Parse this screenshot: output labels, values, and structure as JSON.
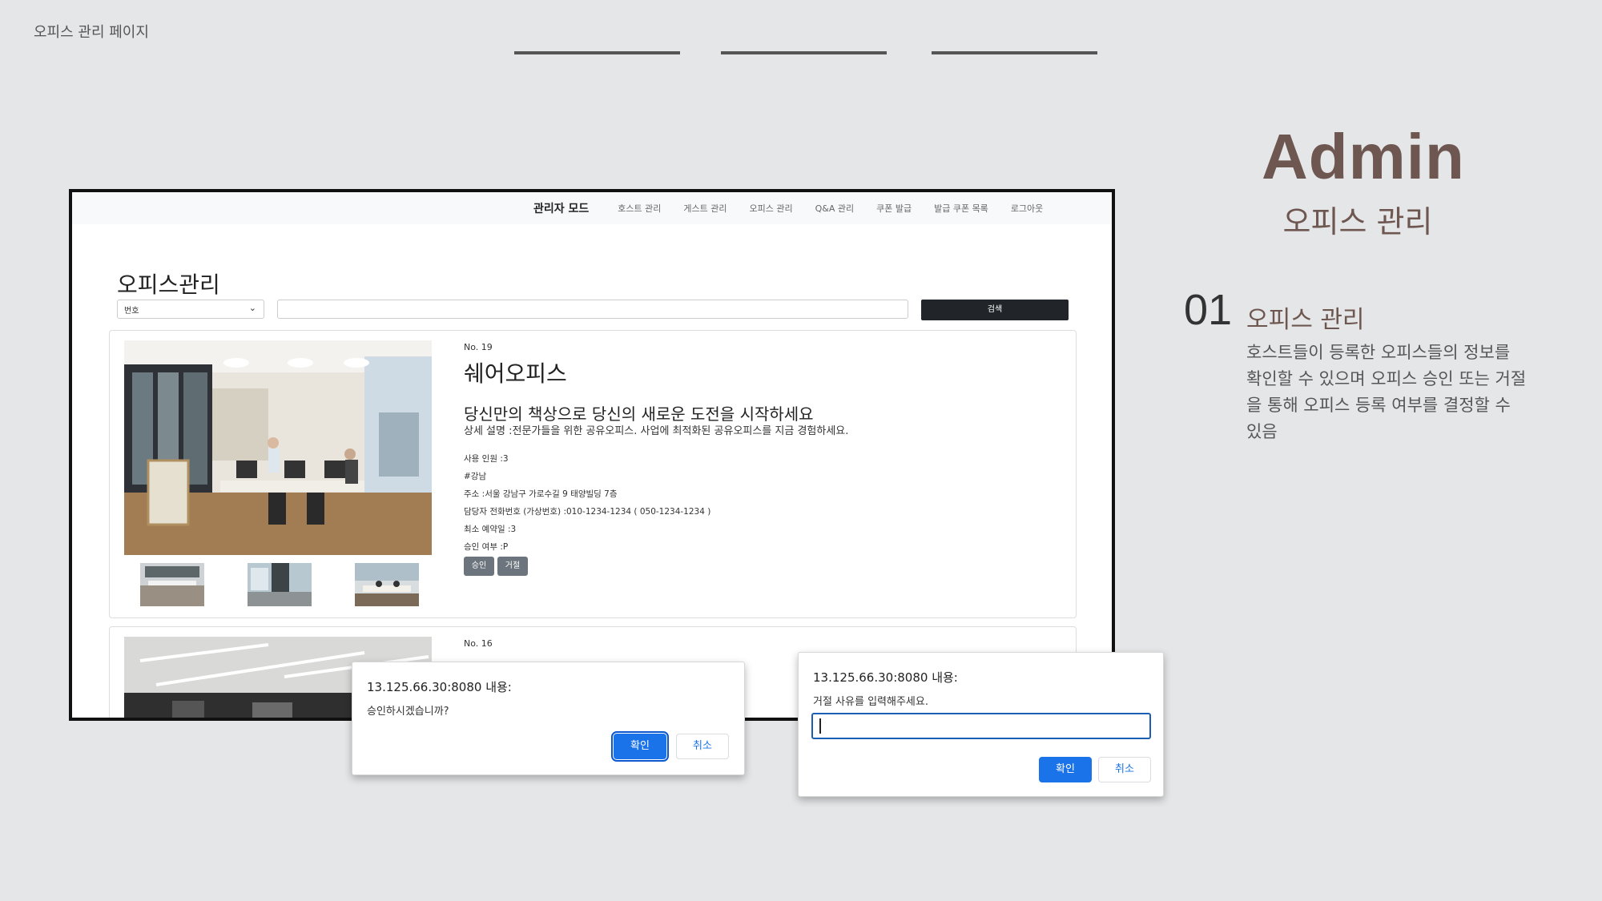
{
  "slide": {
    "title": "오피스 관리 페이지",
    "admin_title": "Admin",
    "admin_subtitle": "오피스 관리",
    "section_number": "01",
    "section_heading": "오피스 관리",
    "section_description": "호스트들이 등록한 오피스들의 정보를 확인할 수 있으며 오피스 승인 또는 거절을 통해 오피스 등록 여부를 결정할 수 있음"
  },
  "nav": {
    "brand": "관리자 모드",
    "items": [
      "호스트 관리",
      "게스트 관리",
      "오피스 관리",
      "Q&A 관리",
      "쿠폰 발급",
      "발급 쿠폰 목록",
      "로그아웃"
    ]
  },
  "page": {
    "heading": "오피스관리",
    "filter_selected": "번호",
    "search_button": "검색"
  },
  "offices": [
    {
      "number": "No. 19",
      "name": "쉐어오피스",
      "tagline": "당신만의 책상으로 당신의 새로운 도전을 시작하세요",
      "detail": "상세 설명 :전문가들을 위한 공유오피스. 사업에 최적화된 공유오피스를 지금 경험하세요.",
      "capacity": "사용 인원 :3",
      "tag": "#강남",
      "address": "주소 :서울 강남구 가로수길 9 태양빌딩 7층",
      "phone": "담당자 전화번호 (가상번호) :010-1234-1234 ( 050-1234-1234 )",
      "min_booking": "최소 예약일 :3",
      "approval": "승인 여부 :P",
      "approve_label": "승인",
      "reject_label": "거절"
    },
    {
      "number": "No. 16"
    }
  ],
  "dialogs": {
    "approve": {
      "title": "13.125.66.30:8080 내용:",
      "message": "승인하시겠습니까?",
      "ok": "확인",
      "cancel": "취소"
    },
    "reject": {
      "title": "13.125.66.30:8080 내용:",
      "message": "거절 사유를 입력해주세요.",
      "input_value": "",
      "ok": "확인",
      "cancel": "취소"
    }
  },
  "colors": {
    "background": "#e5e6e8",
    "accent_brown": "#6e5750",
    "dialog_blue": "#1a73e8",
    "dark_button": "#212529",
    "gray_button": "#6c757d"
  }
}
